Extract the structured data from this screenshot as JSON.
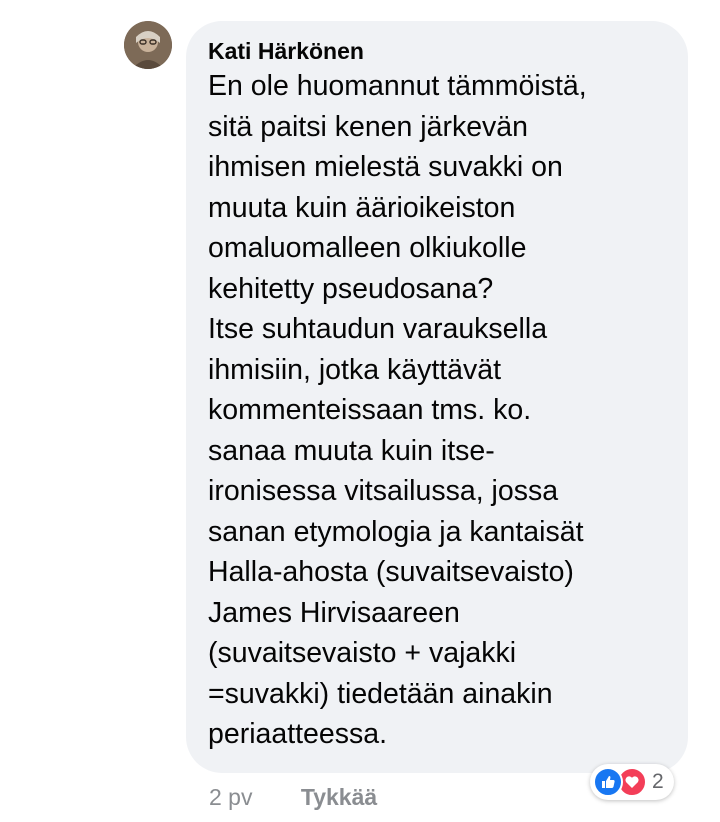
{
  "comment": {
    "author": "Kati Härkönen",
    "text": "En ole huomannut tämmöistä,\nsitä paitsi kenen järkevän\nihmisen  mielestä suvakki on\nmuuta kuin äärioikeiston\nomaluomalleen olkiukolle\nkehitetty pseudosana?\n Itse suhtaudun varauksella\nihmisiin, jotka käyttävät\nkommenteissaan tms.  ko.\nsanaa muuta kuin itse-\nironisessa vitsailussa, jossa\nsanan etymologia ja kantaisät\nHalla-ahosta (suvaitsevaisto)\nJames Hirvisaareen\n(suvaitsevaisto + vajakki\n=suvakki) tiedetään ainakin\nperiaatteessa."
  },
  "meta": {
    "time": "2 pv",
    "like_label": "Tykkää"
  },
  "reactions": {
    "icons": [
      "like-icon",
      "love-icon"
    ],
    "count": "2",
    "colors": {
      "like": "#1877f2",
      "love": "#f33e58"
    }
  }
}
